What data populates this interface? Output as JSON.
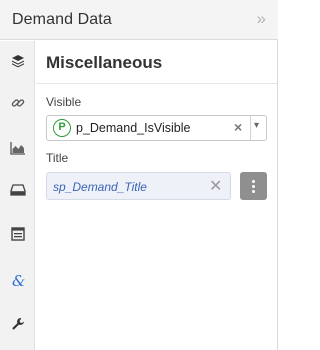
{
  "panel": {
    "title": "Demand Data",
    "collapse_glyph": "»"
  },
  "rail": {
    "items": [
      {
        "icon": "layers-icon",
        "active": false
      },
      {
        "icon": "link-icon",
        "active": false
      },
      {
        "icon": "area-chart-icon",
        "active": false
      },
      {
        "icon": "tray-icon",
        "active": false
      },
      {
        "icon": "list-icon",
        "active": false
      },
      {
        "icon": "ampersand-icon",
        "active": true
      },
      {
        "icon": "wrench-icon",
        "active": false
      }
    ],
    "active_color": "#2f6fd6",
    "icon_color": "#444444"
  },
  "section": {
    "title": "Miscellaneous"
  },
  "fields": {
    "visible": {
      "label": "Visible",
      "badge": "P",
      "value": "p_Demand_IsVisible",
      "clear_glyph": "×",
      "caret_glyph": "▾"
    },
    "title": {
      "label": "Title",
      "value": "sp_Demand_Title",
      "clear_glyph": "✕"
    }
  },
  "colors": {
    "badge_green": "#2e9d3a",
    "binding_blue": "#3a63b8",
    "more_button": "#8f8f8f"
  }
}
